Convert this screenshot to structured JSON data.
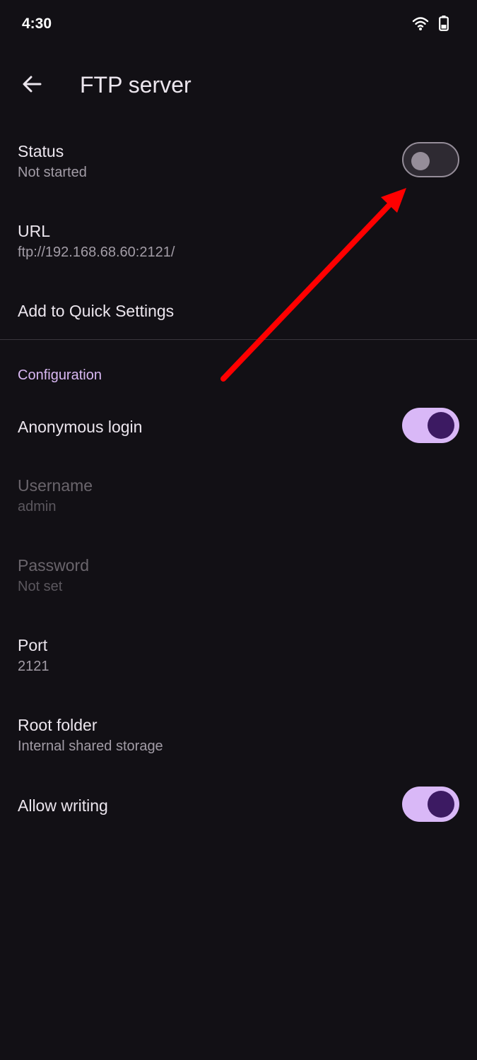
{
  "status_bar": {
    "time": "4:30",
    "icons": [
      "wifi-icon",
      "battery-icon"
    ]
  },
  "app_bar": {
    "back_icon": "arrow-back-icon",
    "title": "FTP server"
  },
  "preferences": {
    "status": {
      "title": "Status",
      "summary": "Not started",
      "switch_on": false
    },
    "url": {
      "title": "URL",
      "summary": "ftp://192.168.68.60:2121/"
    },
    "quick_settings": {
      "title": "Add to Quick Settings"
    }
  },
  "configuration": {
    "header": "Configuration",
    "anonymous_login": {
      "title": "Anonymous login",
      "switch_on": true
    },
    "username": {
      "title": "Username",
      "summary": "admin",
      "enabled": false
    },
    "password": {
      "title": "Password",
      "summary": "Not set",
      "enabled": false
    },
    "port": {
      "title": "Port",
      "summary": "2121"
    },
    "root_folder": {
      "title": "Root folder",
      "summary": "Internal shared storage"
    },
    "allow_writing": {
      "title": "Allow writing",
      "switch_on": true
    }
  },
  "colors": {
    "background": "#121015",
    "accent": "#d9b8f7",
    "annotation_arrow": "#ff0000"
  }
}
